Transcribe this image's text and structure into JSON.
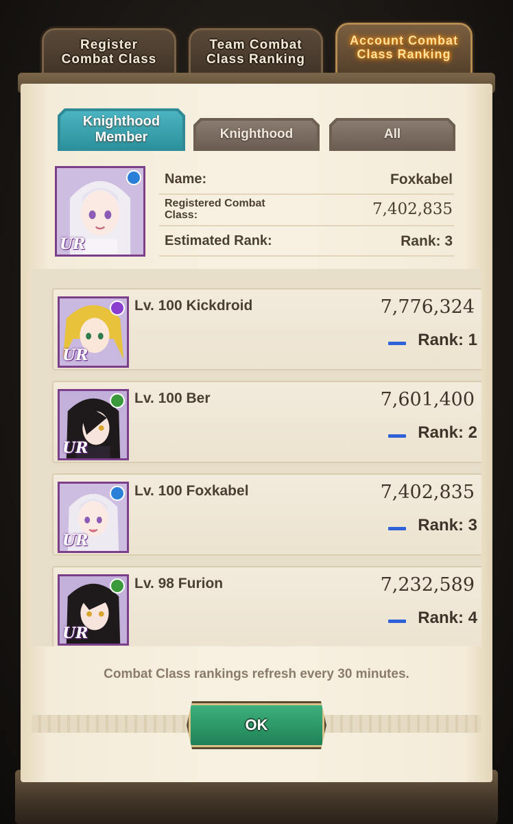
{
  "top_tabs": [
    {
      "label": "Register\nCombat Class",
      "active": false
    },
    {
      "label": "Team Combat\nClass Ranking",
      "active": false
    },
    {
      "label": "Account Combat\nClass Ranking",
      "active": true
    }
  ],
  "sub_tabs": [
    {
      "label": "Knighthood\nMember",
      "active": true
    },
    {
      "label": "Knighthood",
      "active": false
    },
    {
      "label": "All",
      "active": false
    }
  ],
  "profile": {
    "name_label": "Name:",
    "name_value": "Foxkabel",
    "cc_label": "Registered Combat\nClass:",
    "cc_value": "7,402,835",
    "rank_label": "Estimated Rank:",
    "rank_value": "Rank: 3",
    "rarity": "UR",
    "element_color": "#2a7fd6"
  },
  "ranking": [
    {
      "name": "Lv. 100 Kickdroid",
      "score": "7,776,324",
      "rank": "Rank: 1",
      "rarity": "UR",
      "element_color": "#8a3fd0",
      "hair_color": "#e8c23a"
    },
    {
      "name": "Lv. 100 Ber",
      "score": "7,601,400",
      "rank": "Rank: 2",
      "rarity": "UR",
      "element_color": "#3a9a3a",
      "hair_color": "#1e1a1c"
    },
    {
      "name": "Lv. 100 Foxkabel",
      "score": "7,402,835",
      "rank": "Rank: 3",
      "rarity": "UR",
      "element_color": "#2a7fd6",
      "hair_color": "#eeeaf2"
    },
    {
      "name": "Lv. 98 Furion",
      "score": "7,232,589",
      "rank": "Rank: 4",
      "rarity": "UR",
      "element_color": "#3a9a3a",
      "hair_color": "#1e1a1c"
    }
  ],
  "footer_note": "Combat Class rankings refresh every 30 minutes.",
  "ok_label": "OK"
}
